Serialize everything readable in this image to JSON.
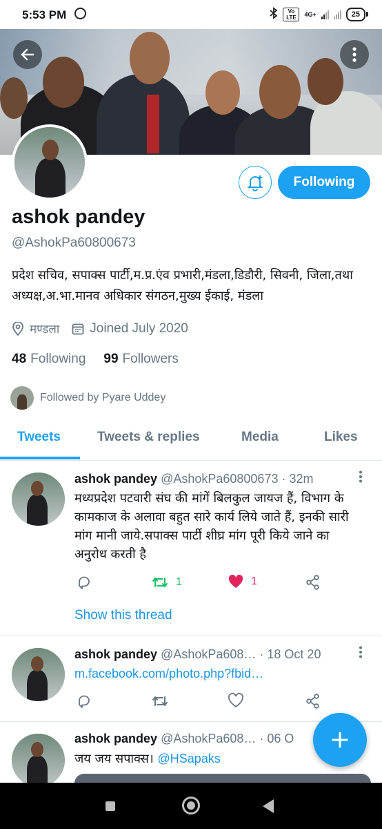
{
  "status_bar": {
    "time": "5:53 PM",
    "battery": "25",
    "network": "4G+",
    "volte": "Vo LTE"
  },
  "profile": {
    "name": "ashok pandey",
    "handle": "@AshokPa60800673",
    "bio": "प्रदेश सचिव, सपाक्स पार्टी,म.प्र.एंव  प्रभारी,मंडला,डिडौरी, सिवनी, जिला,तथा अध्यक्ष,अ.भा.मानव अधिकार संगठन,मुख्य ईकाई, मंडला",
    "location": "मण्डला",
    "joined": "Joined July 2020",
    "following_count": "48",
    "following_label": "Following",
    "followers_count": "99",
    "followers_label": "Followers",
    "followed_by": "Followed by Pyare Uddey",
    "follow_button": "Following"
  },
  "tabs": [
    "Tweets",
    "Tweets & replies",
    "Media",
    "Likes"
  ],
  "active_tab": "Tweets",
  "tweets": [
    {
      "name": "ashok pandey",
      "handle_time": "@AshokPa60800673 · 32m",
      "text": "मध्यप्रदेश पटवारी संघ की मांगें बिलकुल जायज हैं, विभाग के कामकाज के अलावा बहुत सारे कार्य लिये जाते हैं, इनकी सारी मांग मानी जाये.सपाक्स पार्टी शीघ्र मांग पूरी किये जाने का अनुरोध करती है",
      "retweets": "1",
      "likes": "1",
      "show_thread": "Show this thread"
    },
    {
      "name": "ashok pandey",
      "handle_time": "@AshokPa608… · 18 Oct 20",
      "link": "m.facebook.com/photo.php?fbid…"
    },
    {
      "name": "ashok pandey",
      "handle_time": "@AshokPa608… · 06 O",
      "text": "जय जय सपाक्स। ",
      "mention": "@HSapaks"
    }
  ],
  "colors": {
    "accent": "#1da1f2",
    "like": "#e0245e",
    "retweet": "#17bf63",
    "secondary_text": "#657786"
  }
}
